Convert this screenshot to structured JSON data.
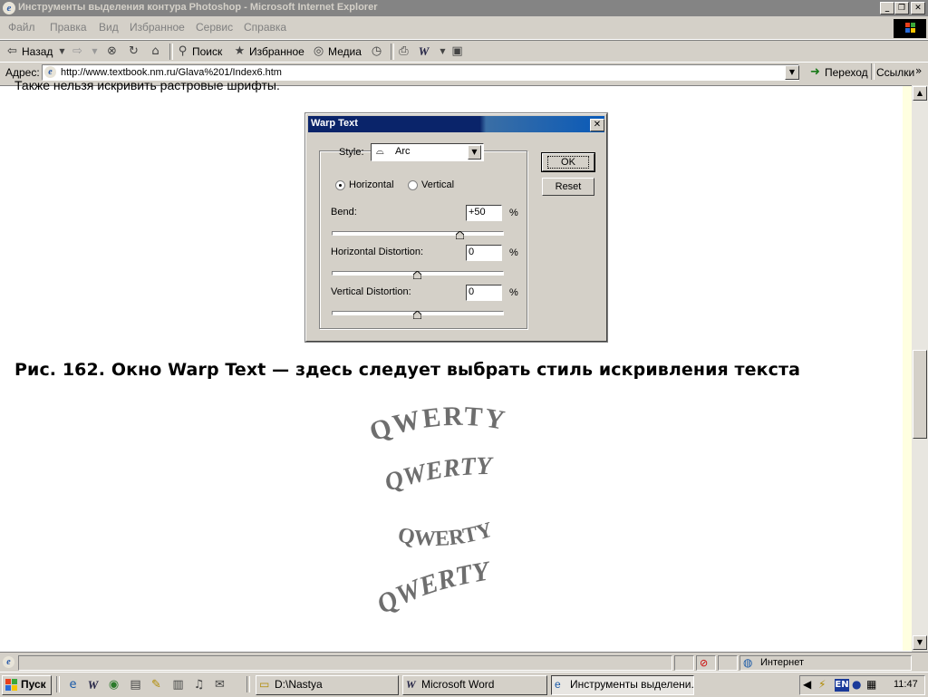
{
  "window": {
    "title": "Инструменты выделения контура Photoshop - Microsoft Internet Explorer",
    "controls": [
      "_",
      "❐",
      "✕"
    ]
  },
  "menu": [
    "Файл",
    "Правка",
    "Вид",
    "Избранное",
    "Сервис",
    "Справка"
  ],
  "toolbar": {
    "back": "Назад",
    "search": "Поиск",
    "favorites": "Избранное",
    "media": "Медиа"
  },
  "address": {
    "label": "Адрес:",
    "url": "http://www.textbook.nm.ru/Glava%201/Index6.htm",
    "go": "Переход",
    "links": "Ссылки"
  },
  "page": {
    "top_text": "Также нельзя искривить растровые шрифты.",
    "caption": "Рис. 162. Окно Warp Text — здесь следует выбрать стиль искривления текста",
    "samples": [
      "QWERTY",
      "QWERTY",
      "QWERTY",
      "QWERTY"
    ]
  },
  "dialog": {
    "title": "Warp Text",
    "style_label": "Style:",
    "style_value": "Arc",
    "horizontal": "Horizontal",
    "vertical": "Vertical",
    "orientation": "horizontal",
    "bend_label": "Bend:",
    "bend_value": "+50",
    "hdist_label": "Horizontal Distortion:",
    "hdist_value": "0",
    "vdist_label": "Vertical Distortion:",
    "vdist_value": "0",
    "percent": "%",
    "ok": "OK",
    "reset": "Reset",
    "sliders": {
      "bend": 0.75,
      "hdist": 0.5,
      "vdist": 0.5
    }
  },
  "statusbar": {
    "zone": "Интернет"
  },
  "taskbar": {
    "start": "Пуск",
    "tasks": [
      "D:\\Nastya",
      "Microsoft Word",
      "Инструменты выделени..."
    ],
    "lang": "EN",
    "clock": "11:47"
  }
}
